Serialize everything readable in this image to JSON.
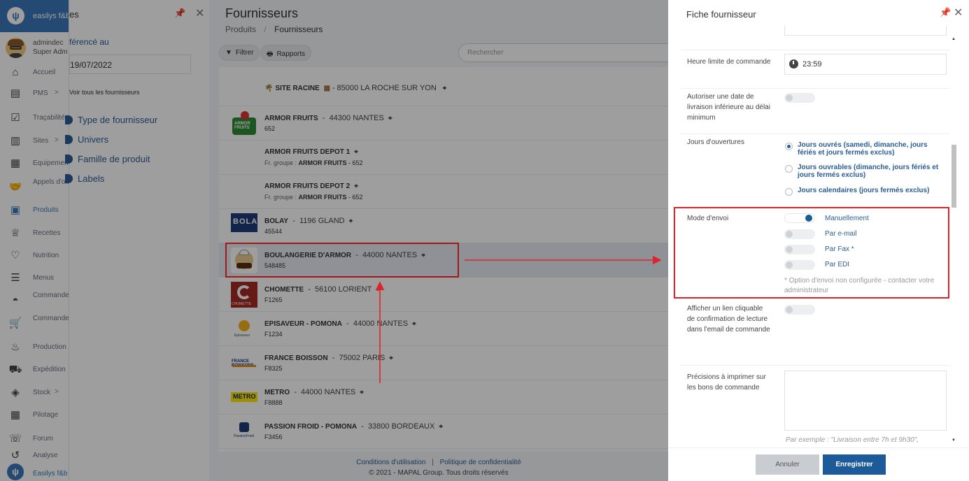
{
  "app": {
    "brand_name": "easilys f&b",
    "footer_brand": "Easilys f&b",
    "brand_color": "#3a78ba"
  },
  "user": {
    "name": "admindec",
    "role": "Super Adm"
  },
  "nav": [
    {
      "label": "Accueil",
      "icon": "home-icon"
    },
    {
      "label": "PMS",
      "icon": "clipboard-icon",
      "chevron": ">"
    },
    {
      "label": "Traçabilité",
      "icon": "clipboard-check-icon"
    },
    {
      "label": "Sites",
      "icon": "building-icon",
      "chevron": ">"
    },
    {
      "label": "Equipements",
      "icon": "calculator-icon"
    },
    {
      "label": "Appels d'offres",
      "icon": "handshake-icon"
    },
    {
      "label": "Produits",
      "icon": "box-icon",
      "active": true
    },
    {
      "label": "Recettes",
      "icon": "chef-hat-icon"
    },
    {
      "label": "Nutrition",
      "icon": "nutrition-icon"
    },
    {
      "label": "Menus",
      "icon": "menu-doc-icon"
    },
    {
      "label": "Commandes convives",
      "icon": "cloche-icon"
    },
    {
      "label": "Commandes fournisseurs",
      "icon": "cart-icon"
    },
    {
      "label": "Production",
      "icon": "pot-icon"
    },
    {
      "label": "Expédition",
      "icon": "truck-icon"
    },
    {
      "label": "Stock",
      "icon": "stack-icon",
      "chevron": ">"
    },
    {
      "label": "Pilotage",
      "icon": "calculator-icon"
    },
    {
      "label": "Forum",
      "icon": "chat-icon"
    },
    {
      "label": "Analyse",
      "icon": "analyse-icon"
    }
  ],
  "filters": {
    "title": "es",
    "ref_label": "férencé au",
    "date_value": "19/07/2022",
    "all_link": "Voir tous les fournisseurs",
    "groups": [
      "Type de fournisseur",
      "Univers",
      "Famille de produit",
      "Labels"
    ]
  },
  "main": {
    "title": "Fournisseurs",
    "breadcrumb": [
      "Produits",
      "Fournisseurs"
    ],
    "filter_button": "Filtrer",
    "reports_button": "Rapports",
    "search_placeholder": "Rechercher",
    "site": {
      "name": "SITE RACINE",
      "address": "85000 LA ROCHE SUR YON"
    },
    "suppliers": [
      {
        "name": "ARMOR FRUITS",
        "address": "44300 NANTES",
        "code": "652",
        "logo": "armor"
      },
      {
        "name": "ARMOR FRUITS DEPOT 1",
        "address": "",
        "code": "652",
        "group_label": "Fr. groupe :",
        "group_name": "ARMOR FRUITS",
        "logo": ""
      },
      {
        "name": "ARMOR FRUITS DEPOT 2",
        "address": "",
        "code": "652",
        "group_label": "Fr. groupe :",
        "group_name": "ARMOR FRUITS",
        "logo": ""
      },
      {
        "name": "BOLAY",
        "address": "1196 GLAND",
        "code": "45544",
        "logo": "bolay"
      },
      {
        "name": "BOULANGERIE D'ARMOR",
        "address": "44000 NANTES",
        "code": "548485",
        "logo": "boul",
        "selected": true
      },
      {
        "name": "CHOMETTE",
        "address": "56100 LORIENT",
        "code": "F1265",
        "logo": "chom"
      },
      {
        "name": "EPISAVEUR - POMONA",
        "address": "44000 NANTES",
        "code": "F1234",
        "logo": "epis"
      },
      {
        "name": "FRANCE BOISSON",
        "address": "75002 PARIS",
        "code": "F8325",
        "logo": "fb"
      },
      {
        "name": "METRO",
        "address": "44000 NANTES",
        "code": "F8888",
        "logo": "metro"
      },
      {
        "name": "PASSION FROID - POMONA",
        "address": "33800 BORDEAUX",
        "code": "F3456",
        "logo": "pf"
      }
    ],
    "logo_texts": {
      "armor": "ARMOR FRUITS",
      "bolay": "BOLAY",
      "chom": "CHOMETTE",
      "epis": "Episaveur",
      "fb": "FRANCE BOISSONS",
      "metro": "METRO",
      "pf": "PassionFroid"
    },
    "footer_terms": "Conditions d'utilisation",
    "footer_separator": "|",
    "footer_privacy": "Politique de confidentialité",
    "footer_copy": "© 2021 - MAPAL Group. Tous droits réservés"
  },
  "drawer": {
    "title": "Fiche fournisseur",
    "order_deadline_label": "Heure limite de commande",
    "order_deadline_value": "23:59",
    "allow_earlier_label": "Autoriser une date de livraison inférieure au délai minimum",
    "opening_days_label": "Jours d'ouvertures",
    "opening_options": [
      {
        "text": "Jours ouvrés (samedi, dimanche, jours fériés et jours fermés exclus)",
        "selected": true
      },
      {
        "text": "Jours ouvrables (dimanche, jours fériés et jours fermés exclus)",
        "selected": false
      },
      {
        "text": "Jours calendaires (jours fermés exclus)",
        "selected": false
      }
    ],
    "send_mode_label": "Mode d'envoi",
    "send_modes": [
      {
        "label": "Manuellement",
        "on": true
      },
      {
        "label": "Par e-mail",
        "on": false
      },
      {
        "label": "Par Fax *",
        "on": false
      },
      {
        "label": "Par EDI",
        "on": false
      }
    ],
    "send_note": "* Option d'envoi non configurée - contacter votre administrateur",
    "read_link_label": "Afficher un lien cliquable de confirmation de lecture dans l'email de commande",
    "print_label": "Précisions à imprimer sur les bons de commande",
    "print_hint": "Par exemple : \"Livraison entre 7h et 9h30\",",
    "cancel_button": "Annuler",
    "save_button": "Enregistrer",
    "save_color": "#1c5a9a"
  },
  "annotation_color": "#e0232a"
}
